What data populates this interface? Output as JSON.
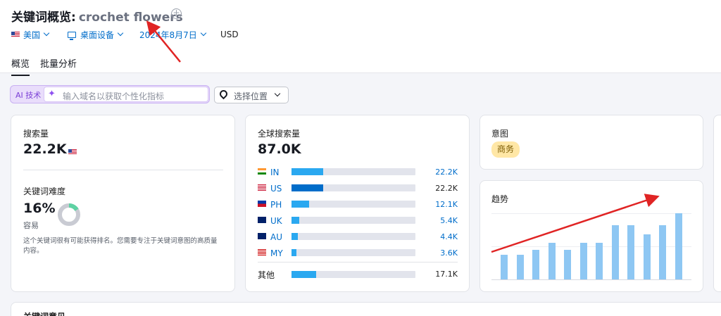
{
  "header": {
    "title_prefix": "关键词概览:",
    "keyword": "crochet flowers",
    "add_icon": "plus-circle-icon",
    "filters": {
      "country": "美国",
      "device": "桌面设备",
      "date": "2024年8月7日",
      "currency": "USD"
    }
  },
  "tabs": [
    {
      "label": "概览",
      "active": true
    },
    {
      "label": "批量分析",
      "active": false
    }
  ],
  "toolbar": {
    "ai_label": "AI 技术",
    "ai_placeholder": "输入域名以获取个性化指标",
    "location_label": "选择位置"
  },
  "volume_card": {
    "label": "搜索量",
    "value": "22.2K"
  },
  "difficulty_card": {
    "label": "关键词难度",
    "value": "16%",
    "level": "容易",
    "percent": 16,
    "description": "这个关键词很有可能获得排名。您需要专注于关键词意图的高质量内容。"
  },
  "global_card": {
    "label": "全球搜索量",
    "value": "87.0K",
    "rows": [
      {
        "code": "IN",
        "volume": "22.2K",
        "share": 0.255,
        "link": true,
        "highlight": false
      },
      {
        "code": "US",
        "volume": "22.2K",
        "share": 0.255,
        "link": false,
        "highlight": true
      },
      {
        "code": "PH",
        "volume": "12.1K",
        "share": 0.14,
        "link": true,
        "highlight": false
      },
      {
        "code": "UK",
        "volume": "5.4K",
        "share": 0.062,
        "link": true,
        "highlight": false
      },
      {
        "code": "AU",
        "volume": "4.4K",
        "share": 0.05,
        "link": true,
        "highlight": false
      },
      {
        "code": "MY",
        "volume": "3.6K",
        "share": 0.041,
        "link": true,
        "highlight": false
      }
    ],
    "other": {
      "label": "其他",
      "volume": "17.1K",
      "share": 0.197
    }
  },
  "intent_card": {
    "label": "意图",
    "badge": "商务",
    "badge_color": "#ffe7a6"
  },
  "trend_card": {
    "label": "趋势",
    "values": [
      0.37,
      0.37,
      0.45,
      0.55,
      0.45,
      0.55,
      0.55,
      0.82,
      0.82,
      0.68,
      0.82,
      1.0
    ],
    "bar_color": "#8ec7f3"
  },
  "bottom_card": {
    "label": "关键词意见"
  },
  "annotations": {
    "arrow_color": "#e02424"
  }
}
